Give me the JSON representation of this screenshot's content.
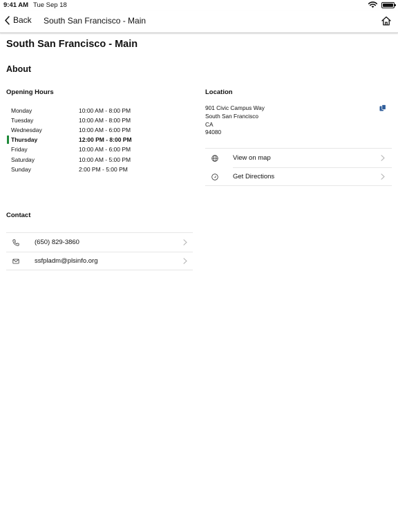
{
  "status_bar": {
    "time": "9:41 AM",
    "date": "Tue Sep 18"
  },
  "nav": {
    "back_label": "Back",
    "title": "South San Francisco - Main"
  },
  "page": {
    "title": "South San Francisco - Main",
    "about_heading": "About"
  },
  "hours": {
    "label": "Opening Hours",
    "rows": [
      {
        "day": "Monday",
        "time": "10:00 AM - 8:00 PM"
      },
      {
        "day": "Tuesday",
        "time": "10:00 AM - 8:00 PM"
      },
      {
        "day": "Wednesday",
        "time": "10:00 AM - 6:00 PM"
      },
      {
        "day": "Thursday",
        "time": "12:00 PM - 8:00 PM"
      },
      {
        "day": "Friday",
        "time": "10:00 AM - 6:00 PM"
      },
      {
        "day": "Saturday",
        "time": "10:00 AM - 5:00 PM"
      },
      {
        "day": "Sunday",
        "time": "2:00 PM - 5:00 PM"
      }
    ],
    "today_day": "Thursday"
  },
  "location": {
    "label": "Location",
    "address_lines": [
      "901 Civic Campus Way",
      "South San Francisco",
      "CA",
      "94080"
    ],
    "actions": [
      {
        "label": "View on map",
        "icon": "globe-icon"
      },
      {
        "label": "Get Directions",
        "icon": "directions-icon"
      }
    ]
  },
  "contact": {
    "label": "Contact",
    "items": [
      {
        "label": "(650) 829-3860",
        "icon": "phone-icon"
      },
      {
        "label": "ssfpladm@plsinfo.org",
        "icon": "mail-icon"
      }
    ]
  },
  "colors": {
    "today_marker": "#1f8a3a",
    "copy_icon": "#2f5d9a",
    "chevron": "#b0b0b0"
  }
}
